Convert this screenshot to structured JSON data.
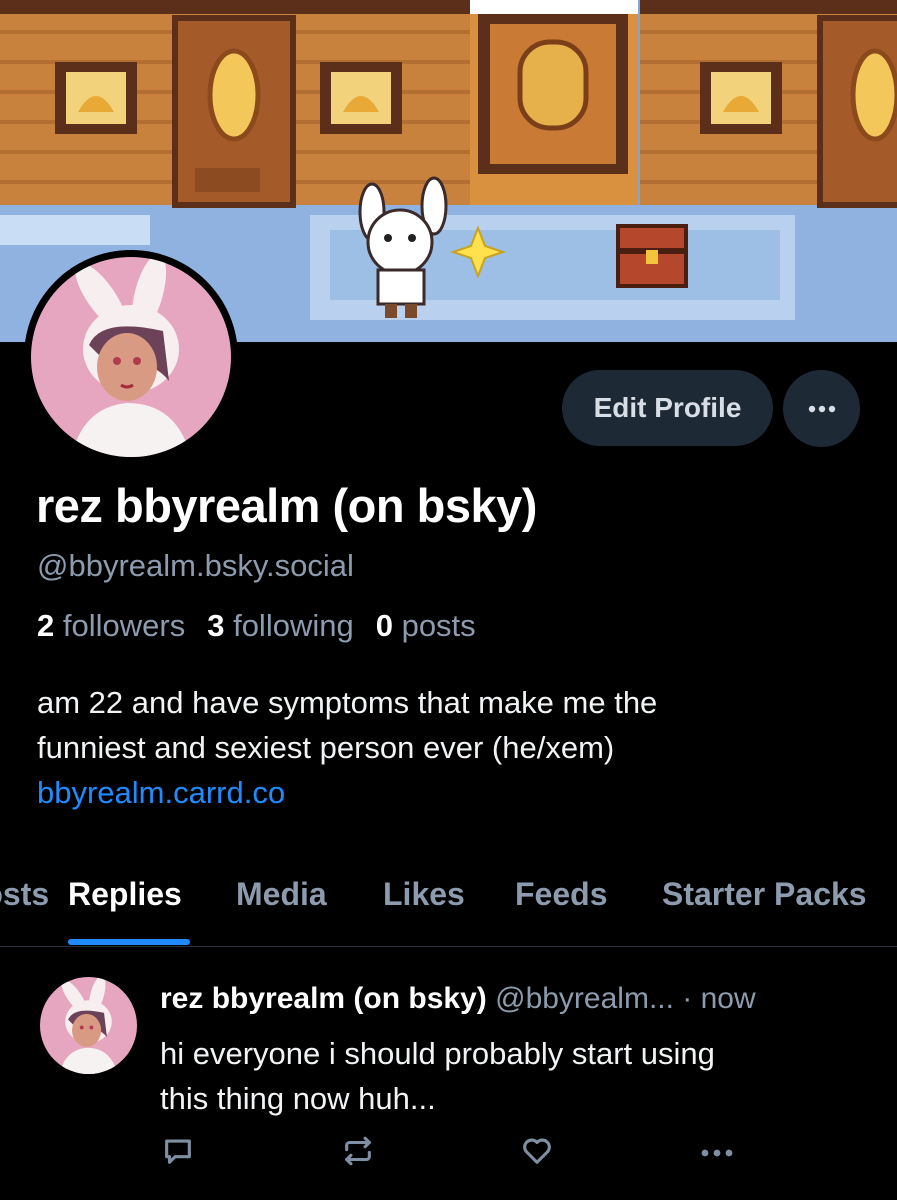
{
  "profile": {
    "display_name": "rez bbyrealm (on bsky)",
    "handle": "@bbyrealm.bsky.social",
    "stats": [
      {
        "num": "2",
        "label": "followers"
      },
      {
        "num": "3",
        "label": "following"
      },
      {
        "num": "0",
        "label": "posts"
      }
    ],
    "bio_lines": [
      "am 22 and have symptoms that make me the",
      "funniest and sexiest person ever (he/xem)"
    ],
    "bio_link": "bbyrealm.carrd.co"
  },
  "buttons": {
    "edit_profile": "Edit Profile"
  },
  "tabs": [
    {
      "label": "Posts"
    },
    {
      "label": "Replies",
      "active": true
    },
    {
      "label": "Media"
    },
    {
      "label": "Likes"
    },
    {
      "label": "Feeds"
    },
    {
      "label": "Starter Packs"
    }
  ],
  "post": {
    "author": "rez bbyrealm (on bsky)",
    "handle": "@bbyrealm...",
    "time": "· now",
    "text_lines": [
      "hi everyone i should probably start using",
      "this thing now huh..."
    ]
  },
  "icons": {
    "more": "ellipsis-icon",
    "reply": "speech-bubble-icon",
    "repost": "repost-icon",
    "like": "heart-icon",
    "post_more": "ellipsis-icon"
  },
  "colors": {
    "accent": "#208bfe",
    "muted_text": "#8c9bae",
    "button_bg": "#1e2936",
    "background": "#000000"
  }
}
